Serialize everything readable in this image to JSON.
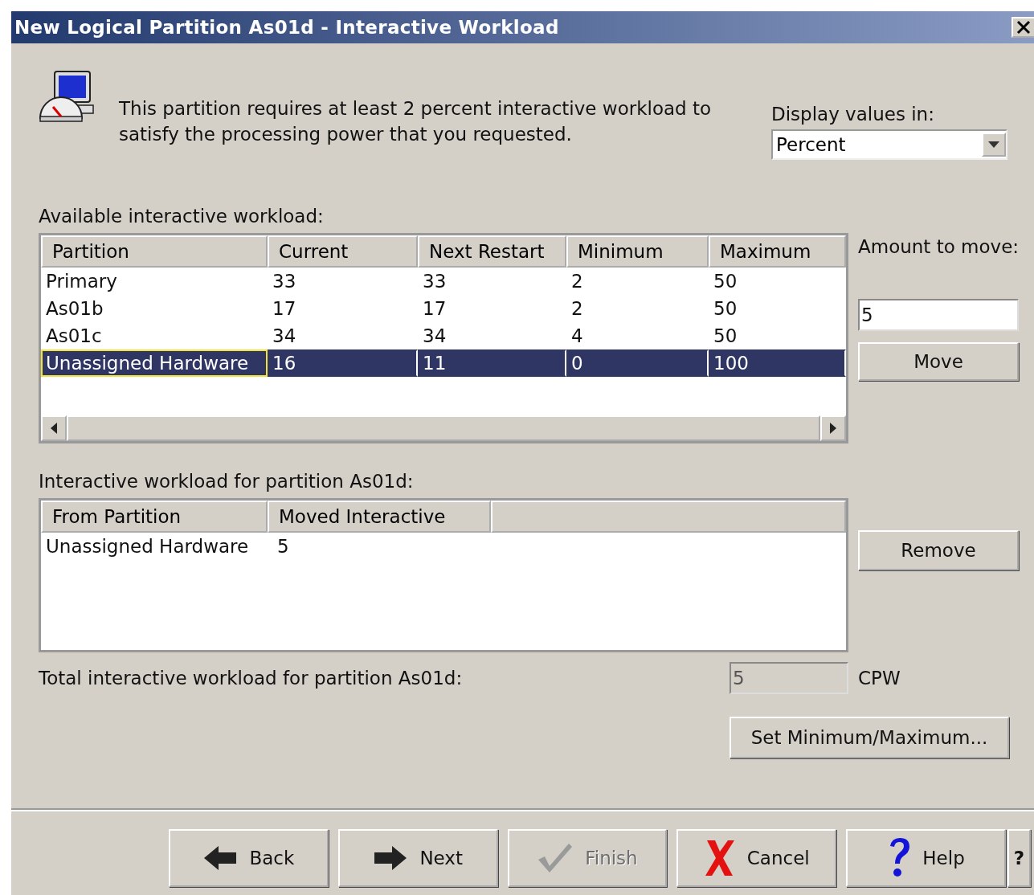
{
  "window": {
    "title": "New Logical Partition As01d - Interactive Workload"
  },
  "message": "This partition requires at least 2 percent interactive workload to satisfy the processing power that you requested.",
  "display_values": {
    "label": "Display values in:",
    "value": "Percent"
  },
  "available": {
    "label": "Available interactive workload:",
    "columns": [
      "Partition",
      "Current",
      "Next Restart",
      "Minimum",
      "Maximum"
    ],
    "rows": [
      {
        "cells": [
          "Primary",
          "33",
          "33",
          "2",
          "50"
        ],
        "selected": false
      },
      {
        "cells": [
          "As01b",
          "17",
          "17",
          "2",
          "50"
        ],
        "selected": false
      },
      {
        "cells": [
          "As01c",
          "34",
          "34",
          "4",
          "50"
        ],
        "selected": false
      },
      {
        "cells": [
          "Unassigned Hardware",
          "16",
          "11",
          "0",
          "100"
        ],
        "selected": true
      }
    ]
  },
  "amount": {
    "label": "Amount to move:",
    "value": "5",
    "button": "Move"
  },
  "moved": {
    "label": "Interactive workload for partition As01d:",
    "columns": [
      "From Partition",
      "Moved Interactive"
    ],
    "rows": [
      {
        "cells": [
          "Unassigned Hardware",
          "5"
        ]
      }
    ],
    "button": "Remove"
  },
  "total": {
    "label": "Total interactive workload for partition As01d:",
    "value": "5",
    "unit": "CPW",
    "disabled": true
  },
  "set_button": "Set Minimum/Maximum...",
  "footer": [
    {
      "kind": "back",
      "label": "Back",
      "disabled": false
    },
    {
      "kind": "next",
      "label": "Next",
      "disabled": false
    },
    {
      "kind": "finish",
      "label": "Finish",
      "disabled": true
    },
    {
      "kind": "cancel",
      "label": "Cancel",
      "disabled": false
    },
    {
      "kind": "help",
      "label": "Help",
      "disabled": false
    }
  ],
  "context_help": "?"
}
